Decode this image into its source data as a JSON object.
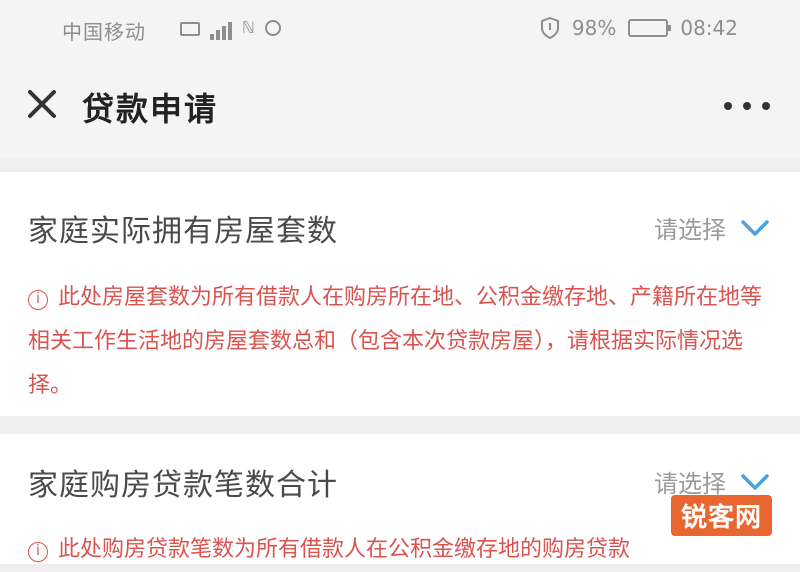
{
  "status_bar": {
    "carrier": "中国移动",
    "extra_glyph": "ℕ",
    "battery_percent": "98%",
    "time": "08:42",
    "battery_level": 0.92
  },
  "header": {
    "title": "贷款申请",
    "close_icon": "close-icon",
    "more_icon": "more-icon"
  },
  "form": {
    "rows": [
      {
        "label": "家庭实际拥有房屋套数",
        "select_placeholder": "请选择",
        "notice_icon": "i",
        "notice": "此处房屋套数为所有借款人在购房所在地、公积金缴存地、产籍所在地等相关工作生活地的房屋套数总和（包含本次贷款房屋），请根据实际情况选择。"
      },
      {
        "label": "家庭购房贷款笔数合计",
        "select_placeholder": "请选择",
        "notice_icon": "i",
        "notice": "此处购房贷款笔数为所有借款人在公积金缴存地的购房贷款"
      }
    ]
  },
  "colors": {
    "accent": "#4aa3df",
    "warning": "#d9534f",
    "background": "#efefef"
  },
  "watermark": "锐客网"
}
